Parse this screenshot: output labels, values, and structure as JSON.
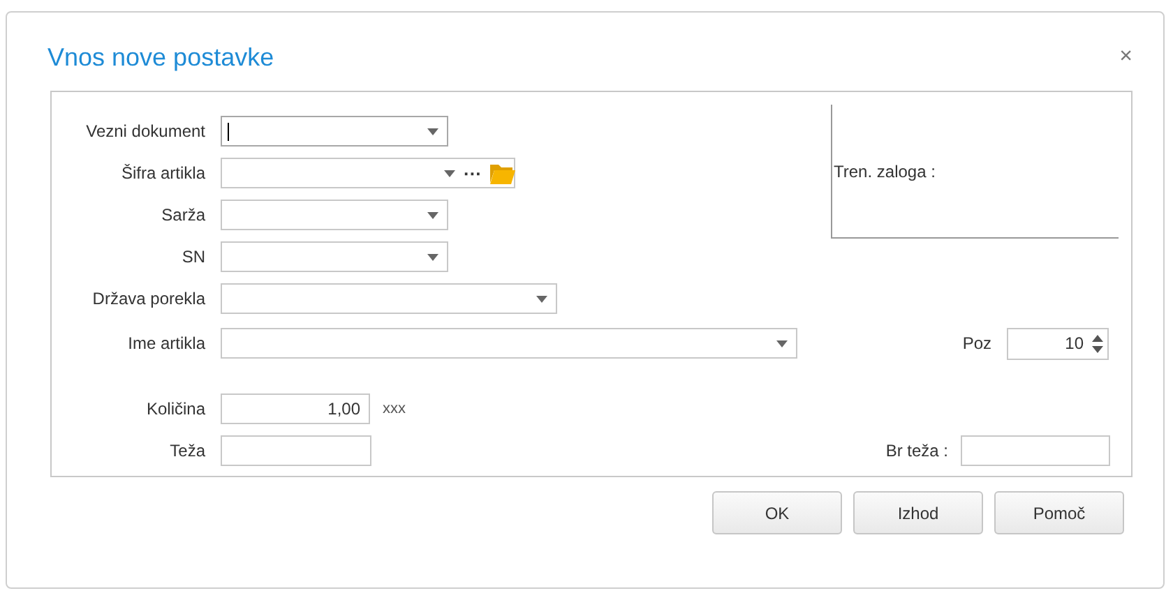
{
  "dialog": {
    "title": "Vnos nove postavke",
    "close": "×"
  },
  "fields": [
    {
      "label": "Vezni dokument",
      "kind": "dropdown",
      "focused": true
    },
    {
      "label": "Šifra artikla",
      "kind": "lookup",
      "focused": false,
      "more": "···"
    },
    {
      "label": "Sarža",
      "kind": "dropdown",
      "focused": false
    },
    {
      "label": "SN",
      "kind": "dropdown",
      "focused": false
    },
    {
      "label": "Država porekla",
      "kind": "dropdown",
      "focused": false
    }
  ],
  "stock": {
    "label": "Tren. zaloga :"
  },
  "item_name": {
    "label": "Ime artikla",
    "kind": "dropdown"
  },
  "position": {
    "label": "Poz",
    "value": "10"
  },
  "quantity": {
    "label": "Količina",
    "value": "1,00",
    "unit": "xxx"
  },
  "weight": {
    "label": "Teža"
  },
  "gross_weight": {
    "label": "Br teža :"
  },
  "buttons": [
    "OK",
    "Izhod",
    "Pomoč"
  ]
}
